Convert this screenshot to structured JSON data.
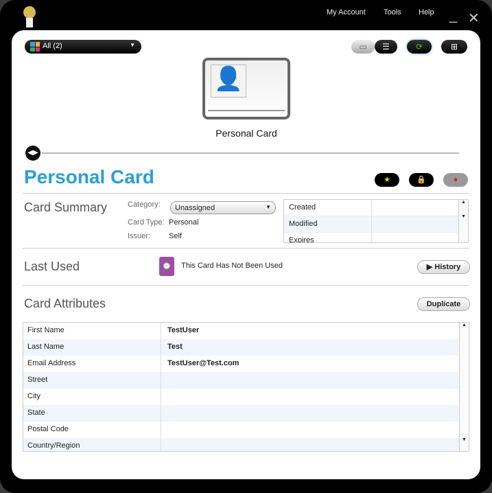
{
  "menu": {
    "my_account": "My Account",
    "tools": "Tools",
    "help": "Help"
  },
  "toolbar": {
    "filter": "All (2)"
  },
  "card": {
    "label": "Personal Card",
    "title": "Personal Card"
  },
  "summary": {
    "heading": "Card Summary",
    "category_label": "Category:",
    "category_value": "Unassigned",
    "type_label": "Card Type:",
    "type_value": "Personal",
    "issuer_label": "Issuer:",
    "issuer_value": "Self",
    "dates": [
      "Created",
      "Modified",
      "Expires"
    ]
  },
  "last_used": {
    "heading": "Last Used",
    "text": "This Card Has Not Been Used",
    "history": "History"
  },
  "attributes": {
    "heading": "Card Attributes",
    "duplicate": "Duplicate",
    "rows": [
      {
        "k": "First Name",
        "v": "TestUser"
      },
      {
        "k": "Last Name",
        "v": "Test"
      },
      {
        "k": "Email Address",
        "v": "TestUser@Test.com"
      },
      {
        "k": "Street",
        "v": ""
      },
      {
        "k": "City",
        "v": ""
      },
      {
        "k": "State",
        "v": ""
      },
      {
        "k": "Postal Code",
        "v": ""
      },
      {
        "k": "Country/Region",
        "v": ""
      }
    ]
  },
  "colors": {
    "accent": "#2aa0d8",
    "watch": "#9b4fa8"
  }
}
